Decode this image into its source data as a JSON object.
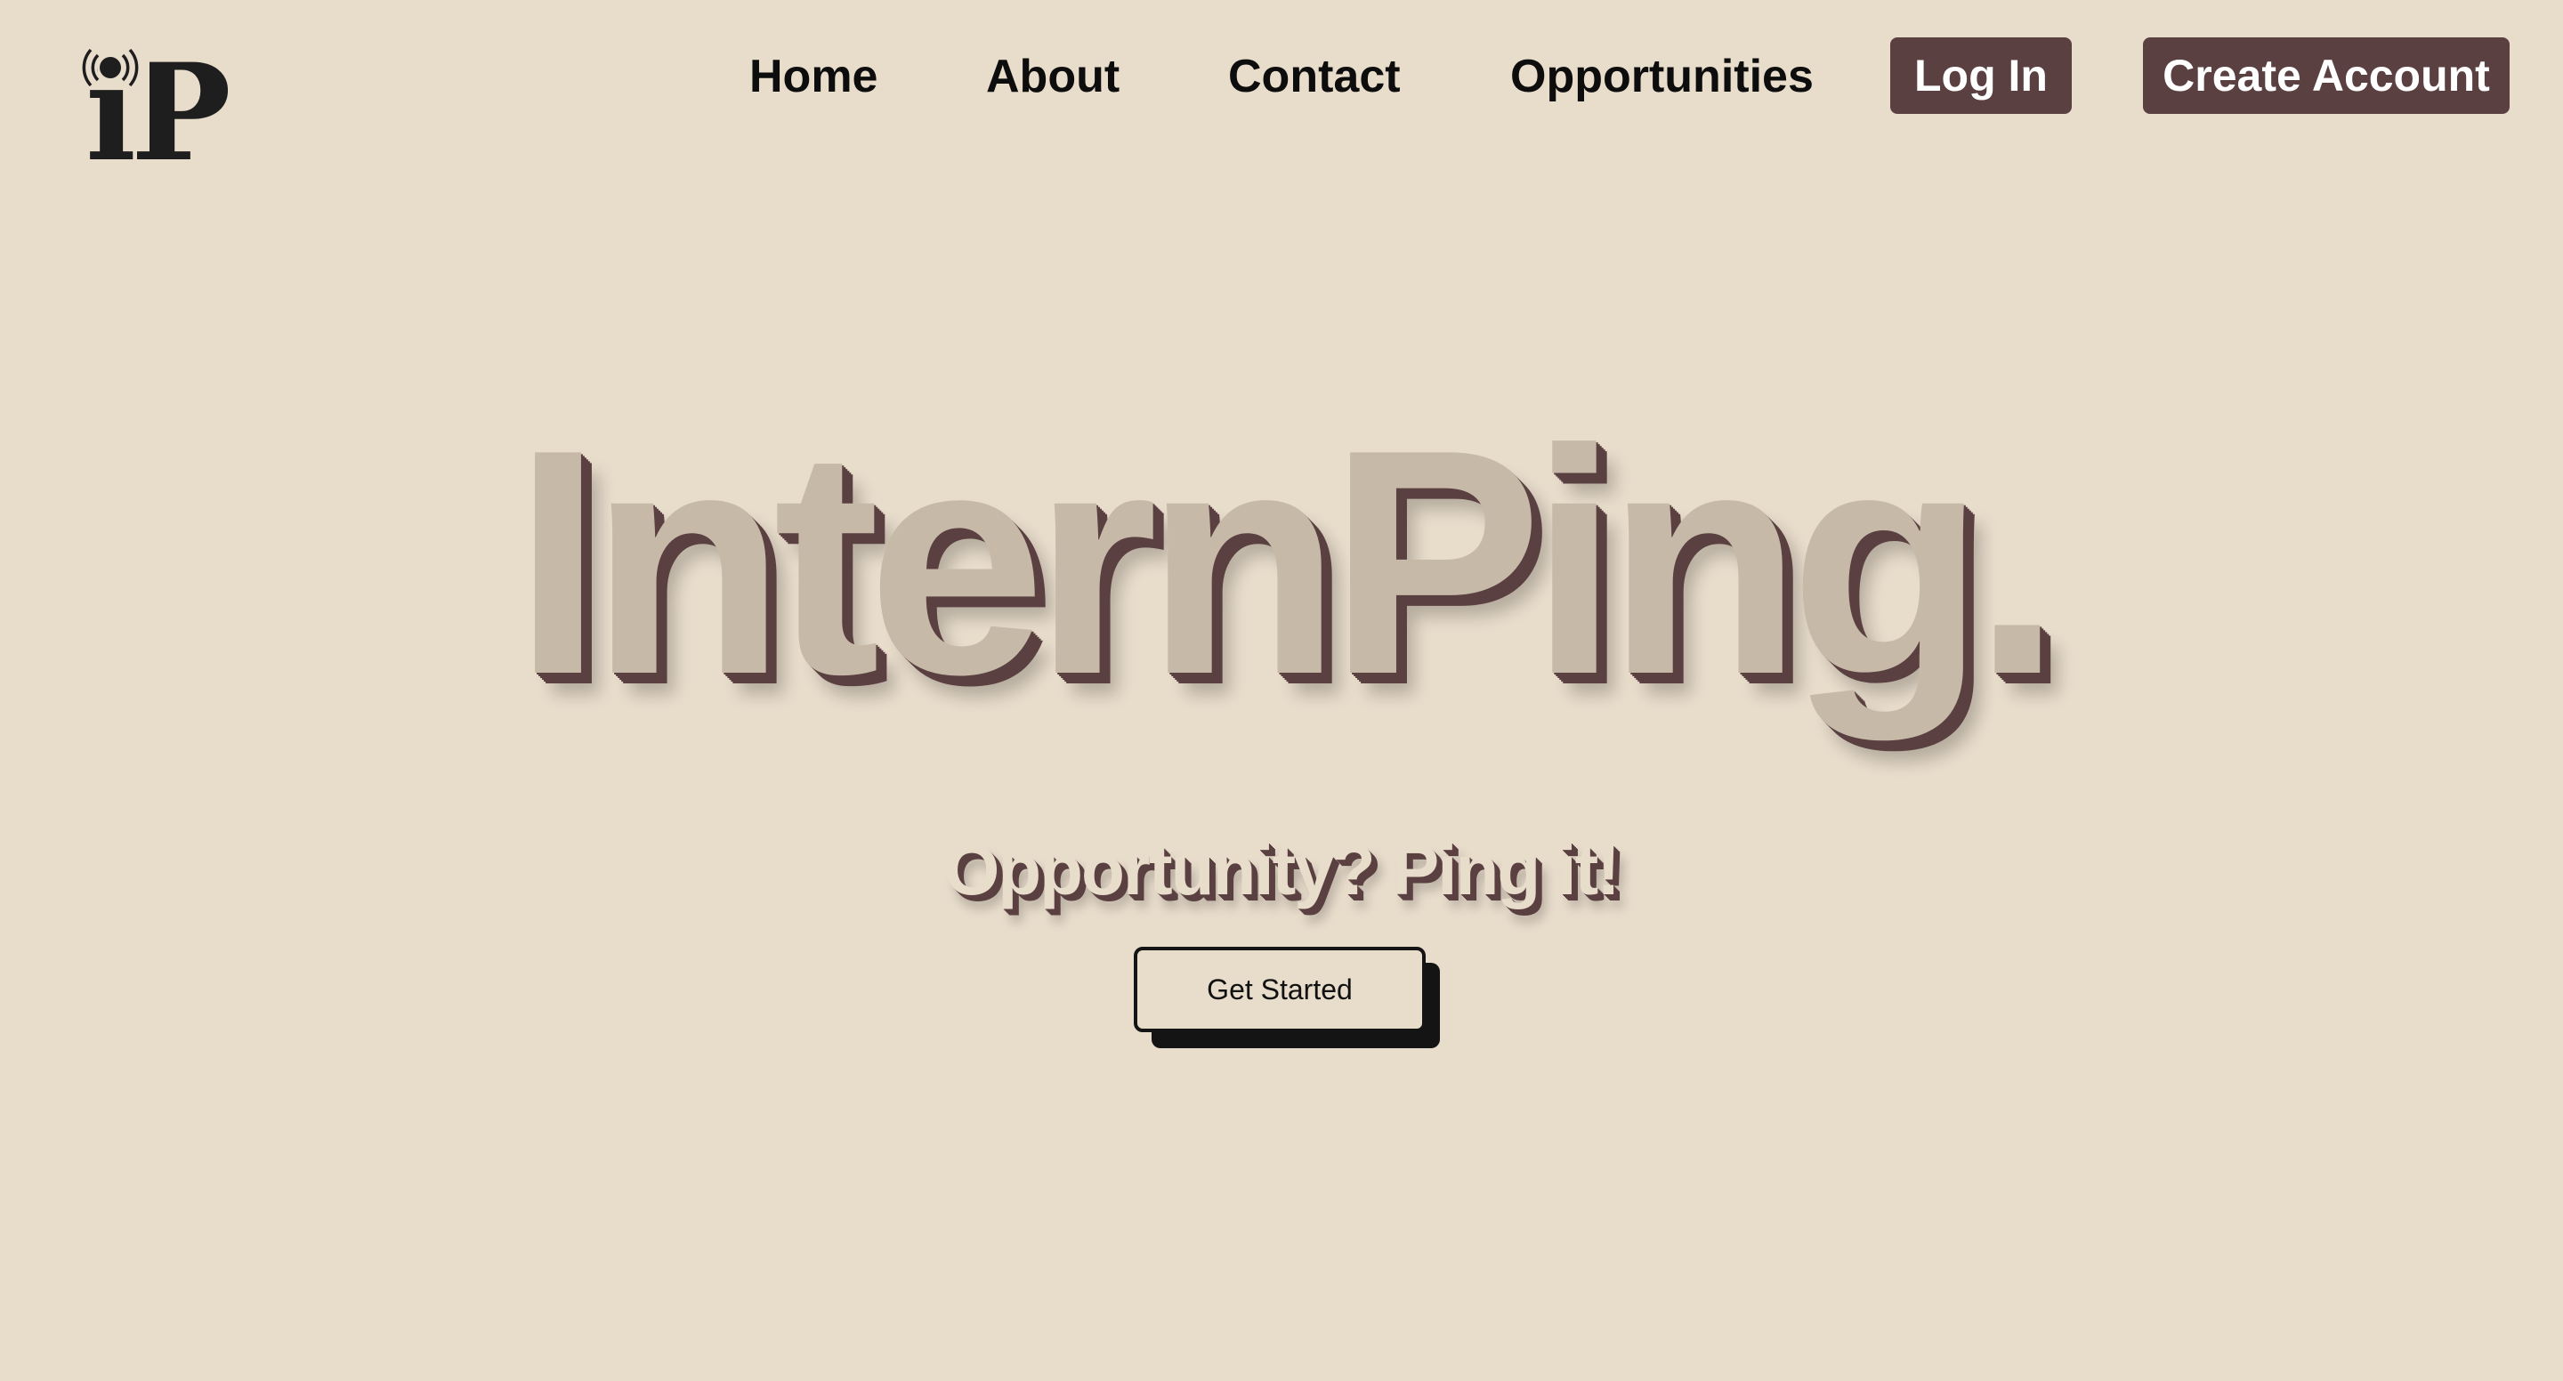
{
  "logo": {
    "text": "iP",
    "signal_icon": "broadcast-icon"
  },
  "nav": {
    "links": [
      {
        "label": "Home"
      },
      {
        "label": "About"
      },
      {
        "label": "Contact"
      },
      {
        "label": "Opportunities"
      }
    ],
    "login_label": "Log In",
    "create_account_label": "Create Account"
  },
  "hero": {
    "title": "InternPing.",
    "tagline": "Opportunity? Ping it!",
    "cta_label": "Get Started"
  },
  "colors": {
    "background": "#e8dccb",
    "accent": "#5a4040",
    "title_fill": "#c7b9a8",
    "text": "#0d0d0d"
  }
}
